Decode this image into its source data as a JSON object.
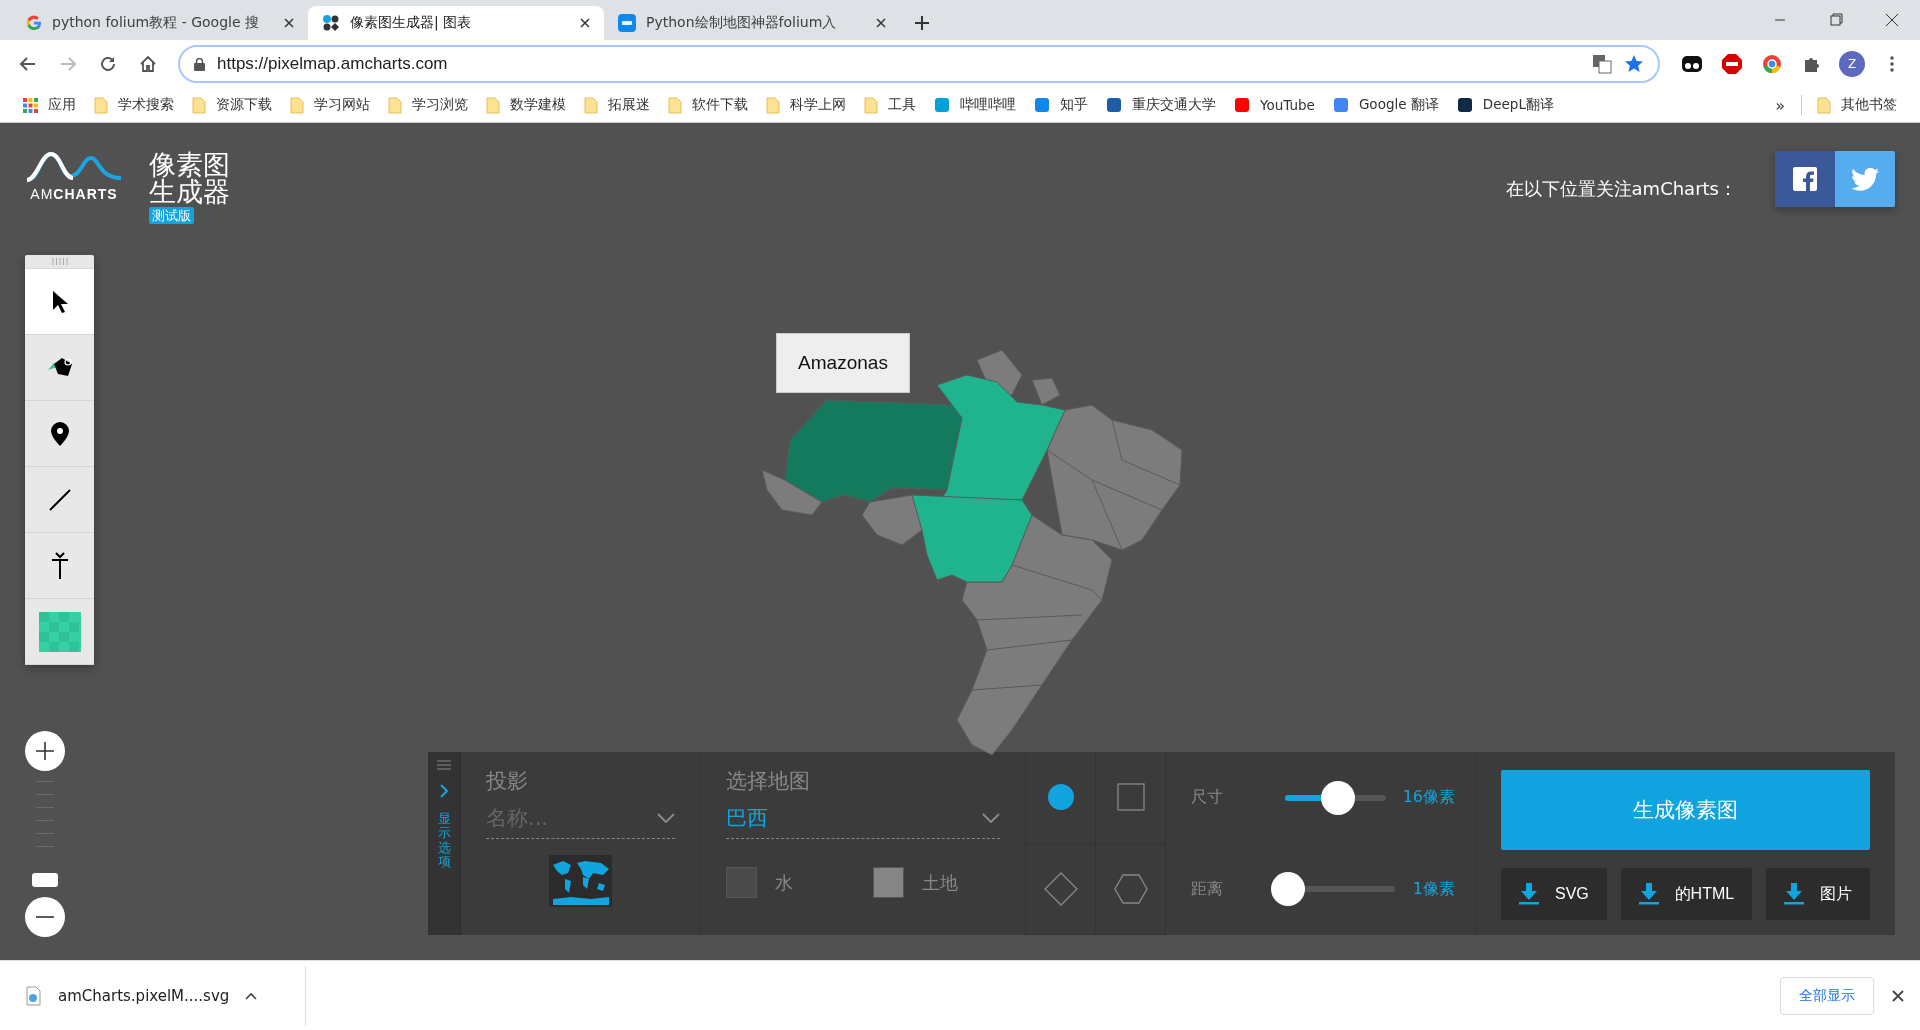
{
  "browser": {
    "tabs": [
      {
        "title": "python folium教程 - Google 搜",
        "kind": "google",
        "selected": false
      },
      {
        "title": "像素图生成器| 图表",
        "kind": "amcharts",
        "selected": true
      },
      {
        "title": "Python绘制地图神器folium入",
        "kind": "zhihu",
        "selected": false
      }
    ],
    "address": "https://pixelmap.amcharts.com",
    "profile_initial": "Z",
    "bookmarks": [
      {
        "label": "应用",
        "kind": "apps"
      },
      {
        "label": "学术搜索",
        "kind": "folder"
      },
      {
        "label": "资源下载",
        "kind": "folder"
      },
      {
        "label": "学习网站",
        "kind": "folder"
      },
      {
        "label": "学习浏览",
        "kind": "folder"
      },
      {
        "label": "数学建模",
        "kind": "folder"
      },
      {
        "label": "拓展迷",
        "kind": "folder"
      },
      {
        "label": "软件下载",
        "kind": "folder"
      },
      {
        "label": "科学上网",
        "kind": "folder"
      },
      {
        "label": "工具",
        "kind": "folder"
      },
      {
        "label": "哔哩哔哩",
        "kind": "site",
        "color": "#00a1d6"
      },
      {
        "label": "知乎",
        "kind": "site",
        "color": "#0f88eb"
      },
      {
        "label": "重庆交通大学",
        "kind": "site",
        "color": "#1d5ca6"
      },
      {
        "label": "YouTube",
        "kind": "site",
        "color": "#ff0000"
      },
      {
        "label": "Google 翻译",
        "kind": "site",
        "color": "#4285f4"
      },
      {
        "label": "DeepL翻译",
        "kind": "site",
        "color": "#0f2b46"
      }
    ],
    "overflow": "»",
    "other_bookmarks": "其他书签"
  },
  "header": {
    "logo_text": "AM**CHARTS**",
    "title_lines": [
      "像素图",
      "生成器"
    ],
    "badge": "测试版",
    "follow_text": "在以下位置关注amCharts："
  },
  "tools": [
    {
      "kind": "select",
      "selected": true
    },
    {
      "kind": "fill",
      "selected": false
    },
    {
      "kind": "marker",
      "selected": false
    },
    {
      "kind": "line",
      "selected": false
    },
    {
      "kind": "text",
      "selected": false
    },
    {
      "kind": "color",
      "selected": false
    }
  ],
  "zoom": {
    "level": 0
  },
  "map": {
    "tooltip": "Amazonas"
  },
  "options": {
    "toggle_label": "显示选项",
    "projection": {
      "label": "投影",
      "placeholder": "名称..."
    },
    "map_select": {
      "label": "选择地图",
      "value": "巴西"
    },
    "swatches": [
      {
        "label": "水",
        "color": "#4a4a4a"
      },
      {
        "label": "土地",
        "color": "#858585"
      }
    ],
    "shapes": [
      {
        "kind": "circle",
        "selected": true
      },
      {
        "kind": "square",
        "selected": false
      },
      {
        "kind": "diamond",
        "selected": false
      },
      {
        "kind": "hexagon",
        "selected": false
      }
    ],
    "sliders": [
      {
        "label": "尺寸",
        "level": 0.53,
        "reading": "16像素"
      },
      {
        "label": "距离",
        "level": 0,
        "reading": "1像素"
      }
    ],
    "generate_button": "生成像素图",
    "downloads": [
      "SVG",
      "的HTML",
      "图片"
    ]
  },
  "download_bar": {
    "file": "amCharts.pixelM....svg",
    "show_all": "全部显示"
  }
}
